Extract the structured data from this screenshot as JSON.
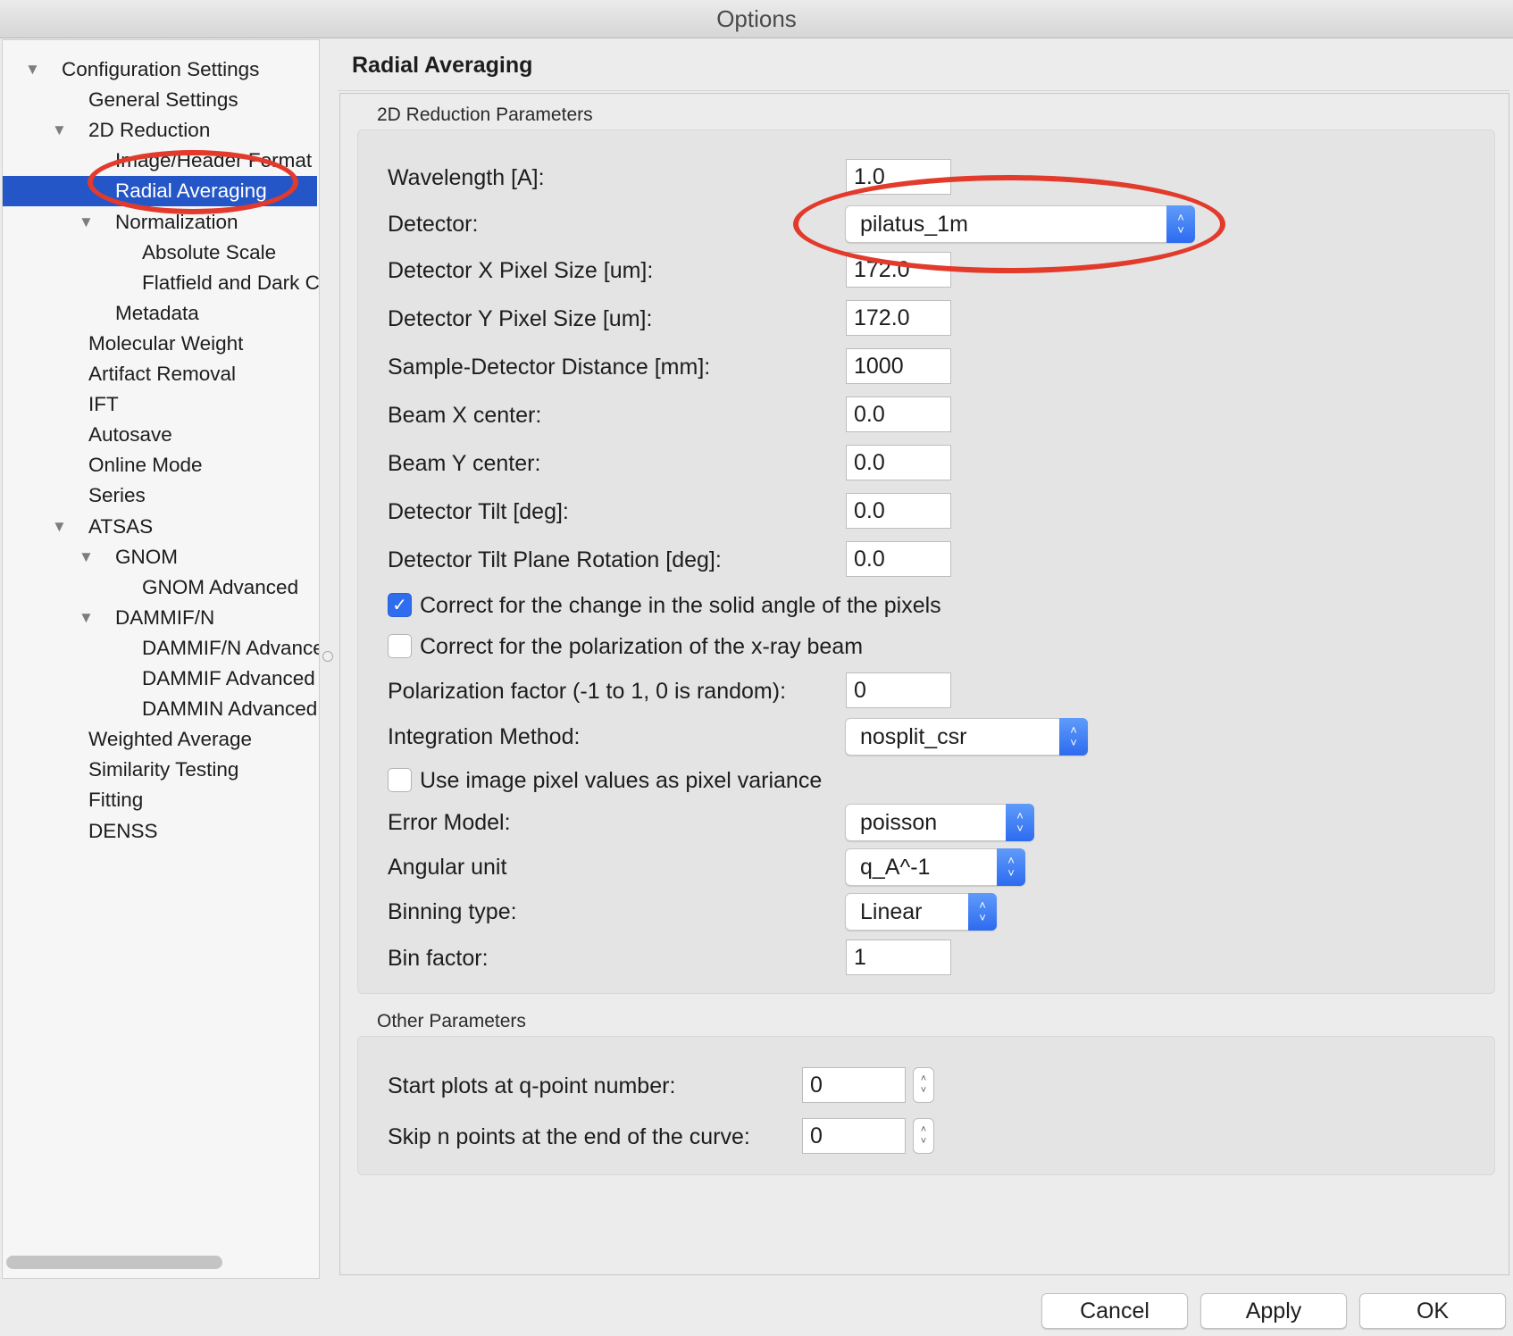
{
  "window": {
    "title": "Options"
  },
  "sidebar": {
    "items": [
      {
        "label": "Configuration Settings",
        "indent": 0,
        "expanded": true
      },
      {
        "label": "General Settings",
        "indent": 1
      },
      {
        "label": "2D Reduction",
        "indent": 1,
        "expanded": true
      },
      {
        "label": "Image/Header Format",
        "indent": 2
      },
      {
        "label": "Radial Averaging",
        "indent": 2,
        "selected": true
      },
      {
        "label": "Normalization",
        "indent": 2,
        "expanded": true
      },
      {
        "label": "Absolute Scale",
        "indent": 3
      },
      {
        "label": "Flatfield and Dark C",
        "indent": 3
      },
      {
        "label": "Metadata",
        "indent": 2
      },
      {
        "label": "Molecular Weight",
        "indent": 1
      },
      {
        "label": "Artifact Removal",
        "indent": 1
      },
      {
        "label": "IFT",
        "indent": 1
      },
      {
        "label": "Autosave",
        "indent": 1
      },
      {
        "label": "Online Mode",
        "indent": 1
      },
      {
        "label": "Series",
        "indent": 1
      },
      {
        "label": "ATSAS",
        "indent": 1,
        "expanded": true
      },
      {
        "label": "GNOM",
        "indent": 2,
        "expanded": true
      },
      {
        "label": "GNOM Advanced",
        "indent": 3
      },
      {
        "label": "DAMMIF/N",
        "indent": 2,
        "expanded": true
      },
      {
        "label": "DAMMIF/N Advanced",
        "indent": 3
      },
      {
        "label": "DAMMIF Advanced",
        "indent": 3
      },
      {
        "label": "DAMMIN Advanced",
        "indent": 3
      },
      {
        "label": "Weighted Average",
        "indent": 1
      },
      {
        "label": "Similarity Testing",
        "indent": 1
      },
      {
        "label": "Fitting",
        "indent": 1
      },
      {
        "label": "DENSS",
        "indent": 1
      }
    ]
  },
  "main": {
    "title": "Radial Averaging",
    "reduction": {
      "group_title": "2D Reduction Parameters",
      "wavelength": {
        "label": "Wavelength [A]:",
        "value": "1.0"
      },
      "detector": {
        "label": "Detector:",
        "value": "pilatus_1m"
      },
      "x_pixel": {
        "label": "Detector X Pixel Size [um]:",
        "value": "172.0"
      },
      "y_pixel": {
        "label": "Detector Y Pixel Size [um]:",
        "value": "172.0"
      },
      "distance": {
        "label": "Sample-Detector Distance [mm]:",
        "value": "1000"
      },
      "beam_x": {
        "label": "Beam X center:",
        "value": "0.0"
      },
      "beam_y": {
        "label": "Beam Y center:",
        "value": "0.0"
      },
      "tilt": {
        "label": "Detector Tilt [deg]:",
        "value": "0.0"
      },
      "tilt_rot": {
        "label": "Detector Tilt Plane Rotation [deg]:",
        "value": "0.0"
      },
      "solid_angle": {
        "label": "Correct for the change in the solid angle of the pixels",
        "checked": true
      },
      "polarization": {
        "label": "Correct for the polarization of the x-ray beam",
        "checked": false
      },
      "pol_factor": {
        "label": "Polarization factor (-1 to 1, 0 is random):",
        "value": "0"
      },
      "integration": {
        "label": "Integration Method:",
        "value": "nosplit_csr"
      },
      "variance": {
        "label": "Use image pixel values as pixel variance",
        "checked": false
      },
      "error_model": {
        "label": "Error Model:",
        "value": "poisson"
      },
      "angular_unit": {
        "label": "Angular unit",
        "value": "q_A^-1"
      },
      "binning_type": {
        "label": "Binning type:",
        "value": "Linear"
      },
      "bin_factor": {
        "label": "Bin factor:",
        "value": "1"
      }
    },
    "other": {
      "group_title": "Other Parameters",
      "start_q": {
        "label": "Start plots at q-point number:",
        "value": "0"
      },
      "skip_n": {
        "label": "Skip n points at the end of the curve:",
        "value": "0"
      }
    }
  },
  "buttons": {
    "cancel": "Cancel",
    "apply": "Apply",
    "ok": "OK"
  },
  "icons": {
    "disclosure": "disclosure-triangle-icon",
    "select_arrows": "up-down-chevron-icon",
    "checkmark": "checkmark-icon"
  },
  "colors": {
    "selection": "#2456c8",
    "accent": "#2f6df0",
    "annotation": "#e23a2b"
  }
}
